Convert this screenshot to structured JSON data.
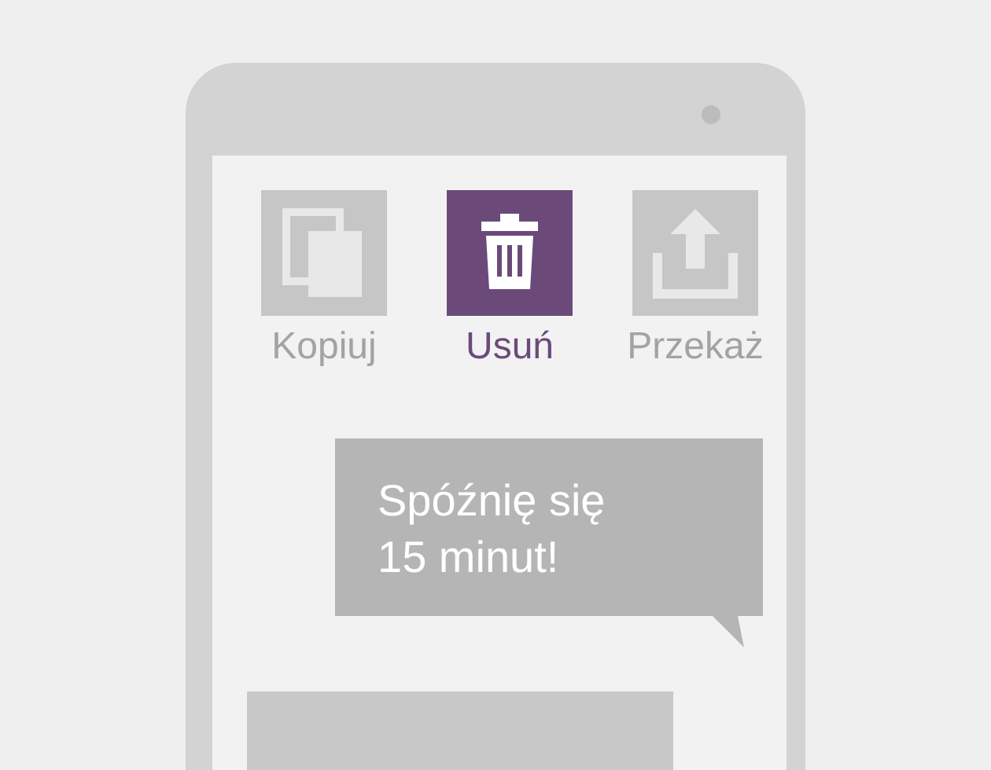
{
  "actions": [
    {
      "kind": "copy",
      "label": "Kopiuj",
      "selected": false
    },
    {
      "kind": "delete",
      "label": "Usuń",
      "selected": true
    },
    {
      "kind": "forward",
      "label": "Przekaż",
      "selected": false
    }
  ],
  "message": {
    "text": "Spóźnię się 15 minut!"
  }
}
